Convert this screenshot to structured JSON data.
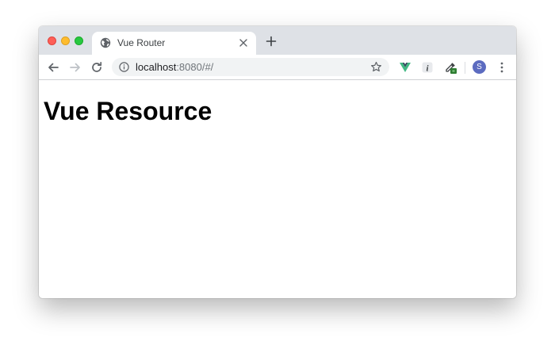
{
  "browser": {
    "tab": {
      "title": "Vue Router",
      "favicon": "globe-icon",
      "close_glyph": "✕"
    },
    "new_tab_icon": "plus-icon",
    "toolbar": {
      "back_icon": "arrow-left-icon",
      "forward_icon": "arrow-right-icon",
      "reload_icon": "reload-icon",
      "address": {
        "host": "localhost",
        "rest": ":8080/#/",
        "info_icon": "info-icon",
        "bookmark_icon": "star-icon"
      },
      "extensions": [
        "vue-devtools-icon",
        "info-italic-icon",
        "eyedropper-icon"
      ],
      "profile_initial": "S",
      "menu_icon": "kebab-menu-icon"
    },
    "colors": {
      "tabstrip": "#dee1e6",
      "vue_green": "#41b883",
      "vue_dark": "#35495e",
      "avatar": "#5c6bc0"
    }
  },
  "page": {
    "heading": "Vue Resource"
  }
}
